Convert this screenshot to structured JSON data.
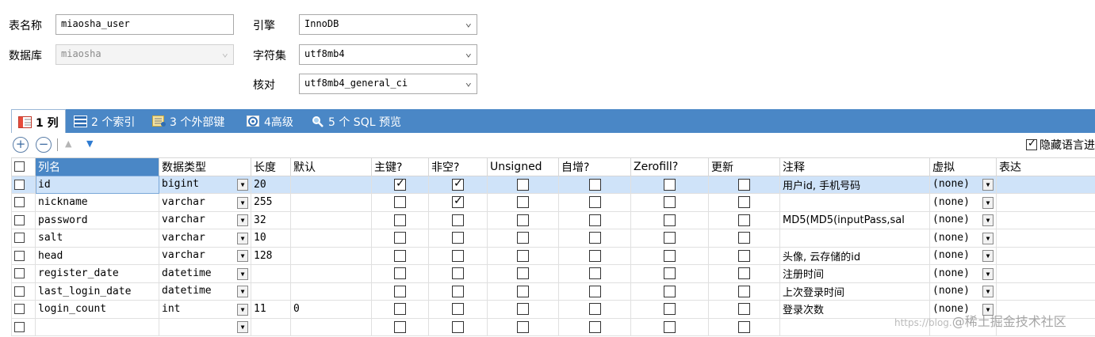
{
  "form": {
    "table_name_label": "表名称",
    "table_name_value": "miaosha_user",
    "database_label": "数据库",
    "database_value": "miaosha",
    "engine_label": "引擎",
    "engine_value": "InnoDB",
    "charset_label": "字符集",
    "charset_value": "utf8mb4",
    "collation_label": "核对",
    "collation_value": "utf8mb4_general_ci"
  },
  "tabs": [
    {
      "label": "1 列",
      "icon": "columns-icon"
    },
    {
      "label": "2 个索引",
      "icon": "index-icon"
    },
    {
      "label": "3 个外部键",
      "icon": "foreign-key-icon"
    },
    {
      "label": "4高级",
      "icon": "advanced-icon"
    },
    {
      "label": "5 个 SQL 预览",
      "icon": "sql-preview-icon"
    }
  ],
  "toolbar": {
    "add_symbol": "+",
    "remove_symbol": "−",
    "up_symbol": "▲",
    "down_symbol": "▼",
    "hide_language_label": "隐藏语言进"
  },
  "grid": {
    "headers": [
      "列名",
      "数据类型",
      "长度",
      "默认",
      "主键?",
      "非空?",
      "Unsigned",
      "自增?",
      "Zerofill?",
      "更新",
      "注释",
      "虚拟",
      "表达"
    ],
    "rows": [
      {
        "name": "id",
        "type": "bigint",
        "length": "20",
        "default": "",
        "pk": true,
        "notnull": true,
        "unsigned": false,
        "autoinc": false,
        "zerofill": false,
        "update": false,
        "comment": "用户id, 手机号码",
        "virtual": "(none)"
      },
      {
        "name": "nickname",
        "type": "varchar",
        "length": "255",
        "default": "",
        "pk": false,
        "notnull": true,
        "unsigned": false,
        "autoinc": false,
        "zerofill": false,
        "update": false,
        "comment": "",
        "virtual": "(none)"
      },
      {
        "name": "password",
        "type": "varchar",
        "length": "32",
        "default": "",
        "pk": false,
        "notnull": false,
        "unsigned": false,
        "autoinc": false,
        "zerofill": false,
        "update": false,
        "comment": "MD5(MD5(inputPass,sal",
        "virtual": "(none)"
      },
      {
        "name": "salt",
        "type": "varchar",
        "length": "10",
        "default": "",
        "pk": false,
        "notnull": false,
        "unsigned": false,
        "autoinc": false,
        "zerofill": false,
        "update": false,
        "comment": "",
        "virtual": "(none)"
      },
      {
        "name": "head",
        "type": "varchar",
        "length": "128",
        "default": "",
        "pk": false,
        "notnull": false,
        "unsigned": false,
        "autoinc": false,
        "zerofill": false,
        "update": false,
        "comment": "头像, 云存储的id",
        "virtual": "(none)"
      },
      {
        "name": "register_date",
        "type": "datetime",
        "length": "",
        "default": "",
        "pk": false,
        "notnull": false,
        "unsigned": false,
        "autoinc": false,
        "zerofill": false,
        "update": false,
        "comment": "注册时间",
        "virtual": "(none)"
      },
      {
        "name": "last_login_date",
        "type": "datetime",
        "length": "",
        "default": "",
        "pk": false,
        "notnull": false,
        "unsigned": false,
        "autoinc": false,
        "zerofill": false,
        "update": false,
        "comment": "上次登录时间",
        "virtual": "(none)"
      },
      {
        "name": "login_count",
        "type": "int",
        "length": "11",
        "default": "0",
        "pk": false,
        "notnull": false,
        "unsigned": false,
        "autoinc": false,
        "zerofill": false,
        "update": false,
        "comment": "登录次数",
        "virtual": "(none)"
      },
      {
        "name": "",
        "type": "",
        "length": "",
        "default": "",
        "pk": false,
        "notnull": false,
        "unsigned": false,
        "autoinc": false,
        "zerofill": false,
        "update": false,
        "comment": "",
        "virtual": ""
      }
    ]
  },
  "watermark": {
    "prefix": "https://blog.",
    "text": "@稀土掘金技术社区"
  },
  "colors": {
    "tabbar": "#4a87c6",
    "selected_row": "#cfe3f9"
  }
}
